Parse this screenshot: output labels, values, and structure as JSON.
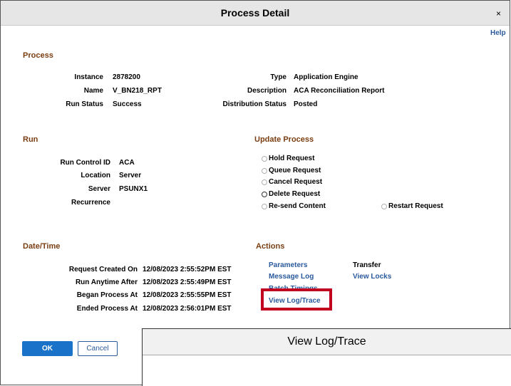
{
  "dialog": {
    "title": "Process Detail",
    "close_label": "×",
    "help_label": "Help"
  },
  "process": {
    "heading": "Process",
    "instance_label": "Instance",
    "instance_value": "2878200",
    "name_label": "Name",
    "name_value": "V_BN218_RPT",
    "run_status_label": "Run Status",
    "run_status_value": "Success",
    "type_label": "Type",
    "type_value": "Application Engine",
    "description_label": "Description",
    "description_value": "ACA Reconciliation Report",
    "distribution_status_label": "Distribution Status",
    "distribution_status_value": "Posted"
  },
  "run": {
    "heading": "Run",
    "run_control_label": "Run Control ID",
    "run_control_value": "ACA",
    "location_label": "Location",
    "location_value": "Server",
    "server_label": "Server",
    "server_value": "PSUNX1",
    "recurrence_label": "Recurrence"
  },
  "update_process": {
    "heading": "Update Process",
    "options": [
      "Hold Request",
      "Queue Request",
      "Cancel Request",
      "Delete Request",
      "Re-send Content",
      "Restart Request"
    ]
  },
  "datetime": {
    "heading": "Date/Time",
    "request_created_label": "Request Created On",
    "request_created_value": "12/08/2023  2:55:52PM EST",
    "run_anytime_label": "Run Anytime After",
    "run_anytime_value": "12/08/2023  2:55:49PM EST",
    "began_label": "Began Process At",
    "began_value": "12/08/2023  2:55:55PM EST",
    "ended_label": "Ended Process At",
    "ended_value": "12/08/2023  2:56:01PM EST"
  },
  "actions": {
    "heading": "Actions",
    "parameters": "Parameters",
    "message_log": "Message Log",
    "batch_timings": "Batch Timings",
    "view_log_trace": "View Log/Trace",
    "transfer": "Transfer",
    "view_locks": "View Locks"
  },
  "buttons": {
    "ok": "OK",
    "cancel": "Cancel"
  },
  "overlay": {
    "title": "View Log/Trace"
  },
  "colors": {
    "section_heading": "#7a3e12",
    "link": "#2a5a9c",
    "primary_button": "#1a73c8",
    "highlight_box": "#c0001e"
  }
}
